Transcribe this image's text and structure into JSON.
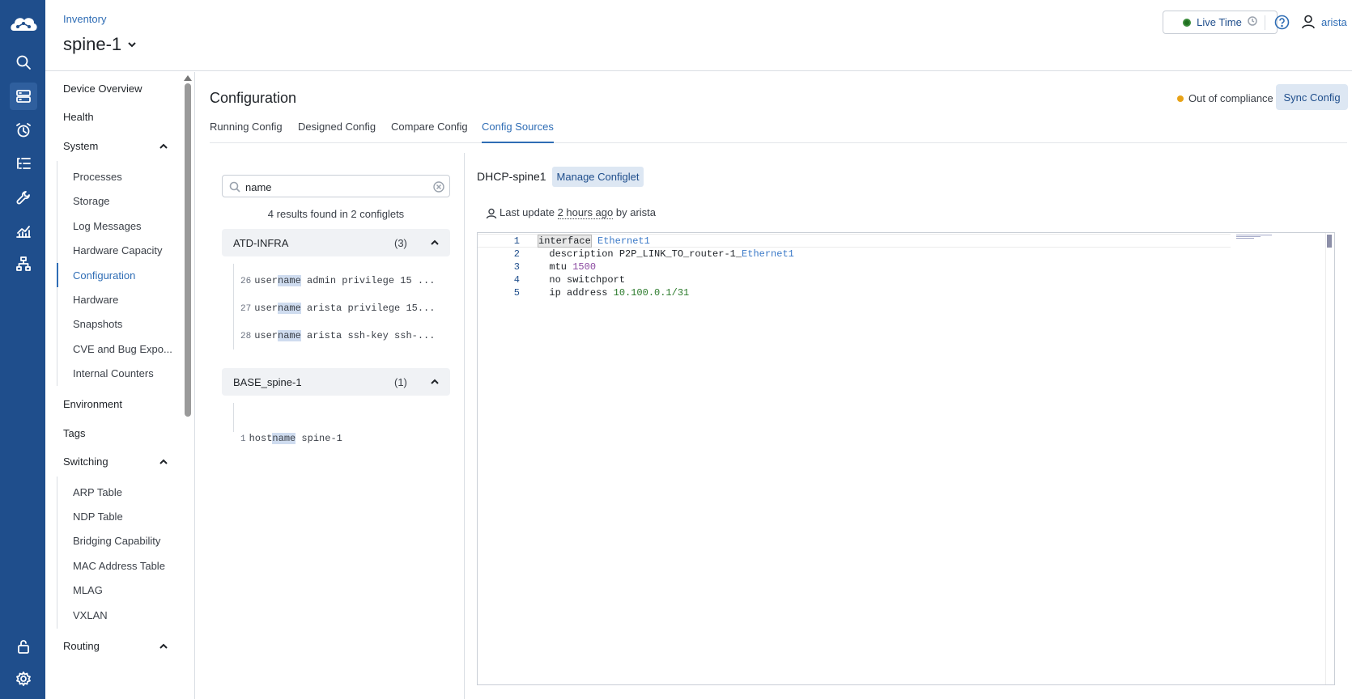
{
  "header": {
    "breadcrumb": "Inventory",
    "device": "spine-1",
    "live_time": "Live Time",
    "user": "arista"
  },
  "rail": {
    "items": [
      "logo-icon",
      "search-icon",
      "devices-icon",
      "alarm-icon",
      "tasks-icon",
      "tools-icon",
      "analytics-icon",
      "topology-icon",
      "lock-icon",
      "settings-icon"
    ],
    "active": "devices-icon",
    "color": "#1f4e8c"
  },
  "nav": {
    "items": {
      "device_overview": "Device Overview",
      "health": "Health",
      "system": "System",
      "environment": "Environment",
      "tags": "Tags",
      "switching": "Switching",
      "routing": "Routing"
    },
    "system_sub": [
      "Processes",
      "Storage",
      "Log Messages",
      "Hardware Capacity",
      "Configuration",
      "Hardware",
      "Snapshots",
      "CVE and Bug Expo...",
      "Internal Counters"
    ],
    "switching_sub": [
      "ARP Table",
      "NDP Table",
      "Bridging Capability",
      "MAC Address Table",
      "MLAG",
      "VXLAN"
    ],
    "active": "Configuration"
  },
  "main": {
    "title": "Configuration",
    "compliance": "Out of compliance",
    "sync_button": "Sync Config",
    "tabs": [
      "Running Config",
      "Designed Config",
      "Compare Config",
      "Config Sources"
    ],
    "active_tab": "Config Sources"
  },
  "search": {
    "value": "name",
    "placeholder": "Search",
    "results": "4 results found in 2 configlets",
    "groups": [
      {
        "name": "ATD-INFRA",
        "count": "(3)",
        "rows": [
          {
            "line": "26",
            "pre": "user",
            "match": "name",
            "post": " admin privilege 15 ..."
          },
          {
            "line": "27",
            "pre": "user",
            "match": "name",
            "post": " arista privilege 15..."
          },
          {
            "line": "28",
            "pre": "user",
            "match": "name",
            "post": " arista ssh-key ssh-..."
          }
        ]
      },
      {
        "name": "BASE_spine-1",
        "count": "(1)",
        "rows": [
          {
            "line": "1",
            "pre": "host",
            "match": "name",
            "post": " spine-1"
          }
        ]
      }
    ]
  },
  "configlet": {
    "name": "DHCP-spine1",
    "manage_button": "Manage Configlet",
    "update_prefix": "Last update",
    "update_time": "2 hours ago",
    "update_suffix": "by arista",
    "lines": [
      {
        "n": "1",
        "indent": "",
        "t1": "interface",
        "t2": " Ethernet1",
        "c2": "blue"
      },
      {
        "n": "2",
        "indent": "  ",
        "t1": "description P2P_LINK_TO_router-1_",
        "t2": "Ethernet1",
        "c2": "blue"
      },
      {
        "n": "3",
        "indent": "  ",
        "t1": "mtu ",
        "t2": "1500",
        "c2": "purple"
      },
      {
        "n": "4",
        "indent": "  ",
        "t1": "no switchport",
        "t2": "",
        "c2": ""
      },
      {
        "n": "5",
        "indent": "  ",
        "t1": "ip address ",
        "t2": "10.100.0.1/31",
        "c2": "green"
      }
    ]
  },
  "colors": {
    "accent": "#2f6db5",
    "compliance_warning": "#e8a317",
    "live_dot": "#1f6f1f"
  }
}
